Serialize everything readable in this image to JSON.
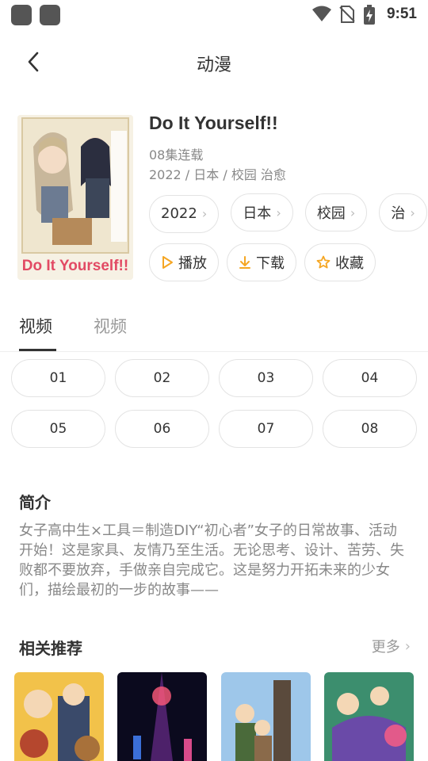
{
  "status_bar": {
    "time": "9:51",
    "icons": [
      "app-square-icon",
      "app-square-icon",
      "wifi-icon",
      "no-sim-icon",
      "battery-charging-icon"
    ]
  },
  "header": {
    "title": "动漫",
    "back_icon": "back-arrow-icon"
  },
  "anime": {
    "title": "Do It Yourself!!",
    "episodes_status": "08集连载",
    "meta": "2022 / 日本 / 校园 治愈",
    "cover_text": "Do It Yourself!!",
    "tags": [
      {
        "label": "2022"
      },
      {
        "label": "日本"
      },
      {
        "label": "校园"
      },
      {
        "label": "治"
      }
    ],
    "actions": {
      "play": "播放",
      "download": "下载",
      "favorite": "收藏"
    }
  },
  "tabs": [
    {
      "label": "视频",
      "active": true
    },
    {
      "label": "视频",
      "active": false
    }
  ],
  "episodes": [
    "01",
    "02",
    "03",
    "04",
    "05",
    "06",
    "07",
    "08"
  ],
  "intro": {
    "heading": "简介",
    "text": "女子高中生×工具＝制造DIY“初心者”女子的日常故事、活动开始！这是家具、友情乃至生活。无论思考、设计、苦劳、失败都不要放弃，手做亲自完成它。这是努力开拓未来的少女们，描绘最初的一步的故事——"
  },
  "related": {
    "heading": "相关推荐",
    "more": "更多"
  },
  "colors": {
    "accent": "#f5a623",
    "text": "#333333",
    "muted": "#888888",
    "border": "#e3e3e3"
  }
}
